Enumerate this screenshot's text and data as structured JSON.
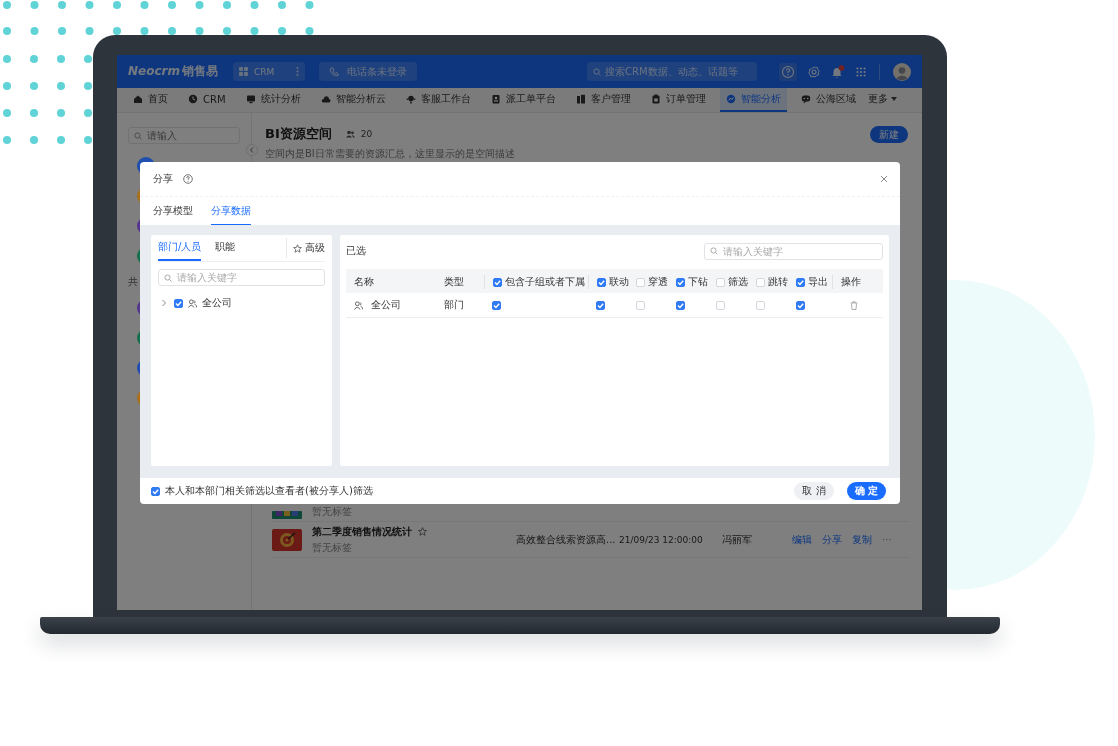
{
  "app_bar": {
    "logo": "Neocrm",
    "logo_suffix": "销售易",
    "app_switcher": "CRM",
    "phone_status": "电话条未登录",
    "search_placeholder": "搜索CRM数据、动态、话题等"
  },
  "nav": [
    {
      "label": "首页",
      "selected": false
    },
    {
      "label": "CRM",
      "selected": false
    },
    {
      "label": "统计分析",
      "selected": false
    },
    {
      "label": "智能分析云",
      "selected": false
    },
    {
      "label": "客服工作台",
      "selected": false
    },
    {
      "label": "派工单平台",
      "selected": false
    },
    {
      "label": "客户管理",
      "selected": false
    },
    {
      "label": "订单管理",
      "selected": false
    },
    {
      "label": "智能分析",
      "selected": true
    },
    {
      "label": "公海区域",
      "selected": false
    }
  ],
  "nav_more": "更多",
  "sidebar": {
    "search_placeholder": "请输入",
    "section_label": "共",
    "avatars_top": [
      {
        "color": "#1f4fae"
      },
      {
        "color": "#a8701a"
      },
      {
        "color": "#56358f"
      },
      {
        "color": "#13704a"
      }
    ],
    "avatars_bottom": [
      {
        "color": "#56358f"
      },
      {
        "color": "#13704a"
      },
      {
        "color": "#1f4fae"
      },
      {
        "color": "#a8701a"
      }
    ]
  },
  "space": {
    "title": "BI资源空间",
    "members": "20",
    "description": "空间内是BI日常需要的资源汇总，这里显示的是空间描述",
    "new_button": "新建"
  },
  "list_rows": [
    {
      "tag": "暂无标签"
    },
    {
      "title": "第二季度销售情况统计",
      "tag": "暂无标签",
      "description": "高效整合线索资源高...",
      "time": "21/09/23 12:00:00",
      "owner": "冯丽军",
      "actions": [
        "编辑",
        "分享",
        "复制"
      ],
      "more": "···"
    }
  ],
  "modal": {
    "title": "分享",
    "tabs": [
      {
        "label": "分享模型",
        "selected": false
      },
      {
        "label": "分享数据",
        "selected": true
      }
    ],
    "left": {
      "tabs": [
        {
          "label": "部门/人员",
          "selected": true
        },
        {
          "label": "职能",
          "selected": false
        }
      ],
      "advanced": "高级",
      "search_placeholder": "请输入关键字",
      "tree": [
        {
          "label": "全公司",
          "checked": true,
          "expanded": false
        }
      ]
    },
    "right": {
      "title": "已选",
      "search_placeholder": "请输入关键字",
      "columns": [
        {
          "kind": "text",
          "label": "名称"
        },
        {
          "kind": "text",
          "label": "类型"
        },
        {
          "kind": "check",
          "label": "包含子组或者下属",
          "checked": true
        },
        {
          "kind": "check",
          "label": "联动",
          "checked": true
        },
        {
          "kind": "check",
          "label": "穿透",
          "checked": false
        },
        {
          "kind": "check",
          "label": "下钻",
          "checked": true
        },
        {
          "kind": "check",
          "label": "筛选",
          "checked": false
        },
        {
          "kind": "check",
          "label": "跳转",
          "checked": false
        },
        {
          "kind": "check",
          "label": "导出",
          "checked": true
        },
        {
          "kind": "action",
          "label": "操作"
        }
      ],
      "rows": [
        {
          "name": "全公司",
          "type": "部门",
          "permissions": [
            true,
            true,
            false,
            true,
            false,
            false,
            true
          ]
        }
      ]
    },
    "footer": {
      "checkbox_label": "本人和本部门相关筛选以查看者(被分享人)筛选",
      "checked": true,
      "buttons": [
        {
          "label": "取 消",
          "kind": "secondary"
        },
        {
          "label": "确 定",
          "kind": "primary"
        }
      ]
    }
  }
}
